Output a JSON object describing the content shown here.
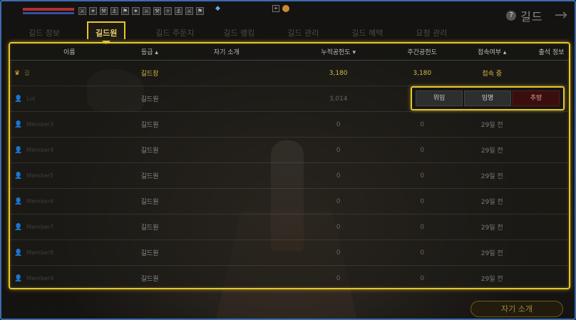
{
  "window": {
    "title": "길드"
  },
  "hud": {
    "skills": [
      "⚔",
      "✶",
      "⚒",
      "⚓",
      "⚑",
      "✦",
      "⚔",
      "⚒",
      "✧",
      "⚓",
      "⚔",
      "⚑"
    ],
    "gem": "◆",
    "plus": "+"
  },
  "tabs": [
    {
      "label": "길드 정보",
      "active": false
    },
    {
      "label": "길드원",
      "active": true
    },
    {
      "label": "길드 주둔지",
      "active": false
    },
    {
      "label": "길드 랭킹",
      "active": false
    },
    {
      "label": "길드 관리",
      "active": false
    },
    {
      "label": "길드 혜택",
      "active": false
    },
    {
      "label": "요청 관리",
      "active": false
    }
  ],
  "table": {
    "headers": {
      "name": "이름",
      "rank": "등급 ▴",
      "intro": "자기 소개",
      "total": "누적공헌도 ▾",
      "week": "주간공헌도",
      "conn": "접속여부 ▴",
      "att": "출석 정보"
    },
    "rows": [
      {
        "icon": "♛",
        "name": "길",
        "rank": "길드장",
        "total": "3,180",
        "week": "3,180",
        "conn": "접속 중",
        "leader": true
      },
      {
        "icon": "👤",
        "name": "Lot",
        "rank": "길드원",
        "total": "3,014",
        "week": "",
        "conn": "",
        "leader": false
      },
      {
        "icon": "👤",
        "name": "Member3",
        "rank": "길드원",
        "total": "0",
        "week": "0",
        "conn": "29일 전",
        "leader": false
      },
      {
        "icon": "👤",
        "name": "Member4",
        "rank": "길드원",
        "total": "0",
        "week": "0",
        "conn": "29일 전",
        "leader": false
      },
      {
        "icon": "👤",
        "name": "Member5",
        "rank": "길드원",
        "total": "0",
        "week": "0",
        "conn": "29일 전",
        "leader": false
      },
      {
        "icon": "👤",
        "name": "Member6",
        "rank": "길드원",
        "total": "0",
        "week": "0",
        "conn": "29일 전",
        "leader": false
      },
      {
        "icon": "👤",
        "name": "Member7",
        "rank": "길드원",
        "total": "0",
        "week": "0",
        "conn": "29일 전",
        "leader": false
      },
      {
        "icon": "👤",
        "name": "Member8",
        "rank": "길드원",
        "total": "0",
        "week": "0",
        "conn": "29일 전",
        "leader": false
      },
      {
        "icon": "👤",
        "name": "Member9",
        "rank": "길드원",
        "total": "0",
        "week": "0",
        "conn": "29일 전",
        "leader": false
      }
    ]
  },
  "actions": {
    "delegate": "위임",
    "appoint": "임명",
    "kick": "추방"
  },
  "footer": {
    "intro_button": "자기 소개"
  },
  "colors": {
    "accent": "#e6c72a",
    "leader": "#d6b94a",
    "danger": "#3a0e0e"
  }
}
